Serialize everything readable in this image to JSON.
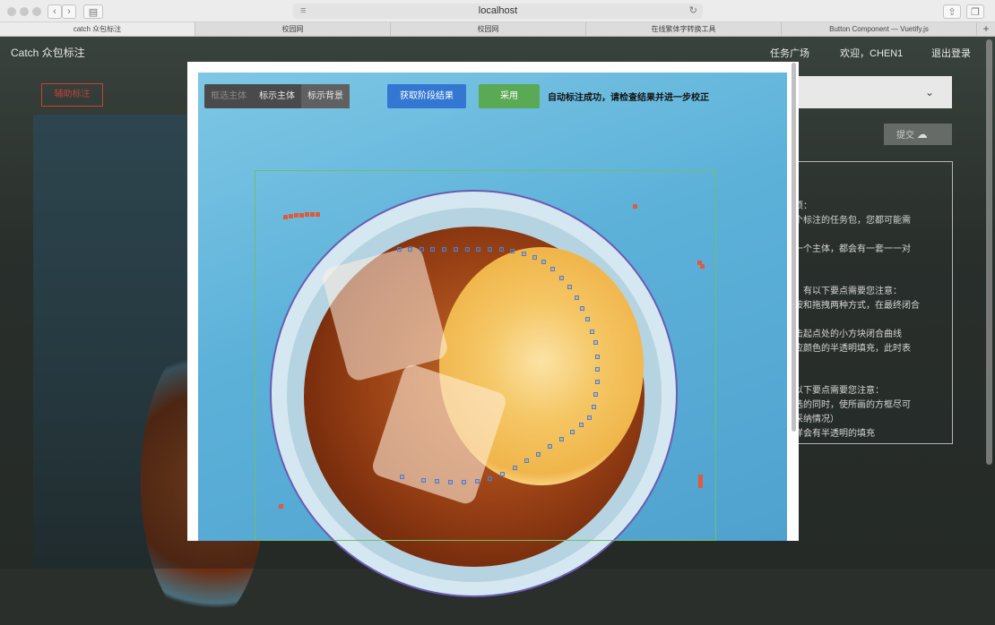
{
  "browser": {
    "url": "localhost",
    "tabs": [
      "catch 众包标注",
      "校园网",
      "校园网",
      "在线繁体字转换工具",
      "Button Component — Vuetify.js"
    ],
    "new_tab_symbol": "+"
  },
  "app": {
    "title": "Catch 众包标注",
    "nav": {
      "tasks": "任务广场",
      "welcome": "欢迎，CHEN1",
      "logout": "退出登录"
    },
    "assist_button": "辅助标注",
    "submit_label": "提交",
    "notes": [
      "事项：",
      "单个标注的任务包，您都可能需",
      "每一个主体，都会有一套一一对",
      "时，有以下要点需要您注意：",
      "拉按和拖拽两种方式，在最终闭合",
      "点击起点处的小方块闭合曲线",
      "相应颜色的半透明填充，此时表",
      "有以下要点需要您注意：",
      "框选的同时，使所画的方框尽可",
      "的采纳情况）",
      "同样会有半透明的填充"
    ]
  },
  "modal": {
    "toolbar": {
      "mode1": "框选主体",
      "mode2": "标示主体",
      "mode3": "标示背景"
    },
    "stage_button": "获取阶段结果",
    "adopt_button": "采用",
    "status": "自动标注成功，请检查结果并进一步校正"
  },
  "colors": {
    "primary": "#3377d2",
    "success": "#5aaa55",
    "danger": "#c2433a"
  }
}
